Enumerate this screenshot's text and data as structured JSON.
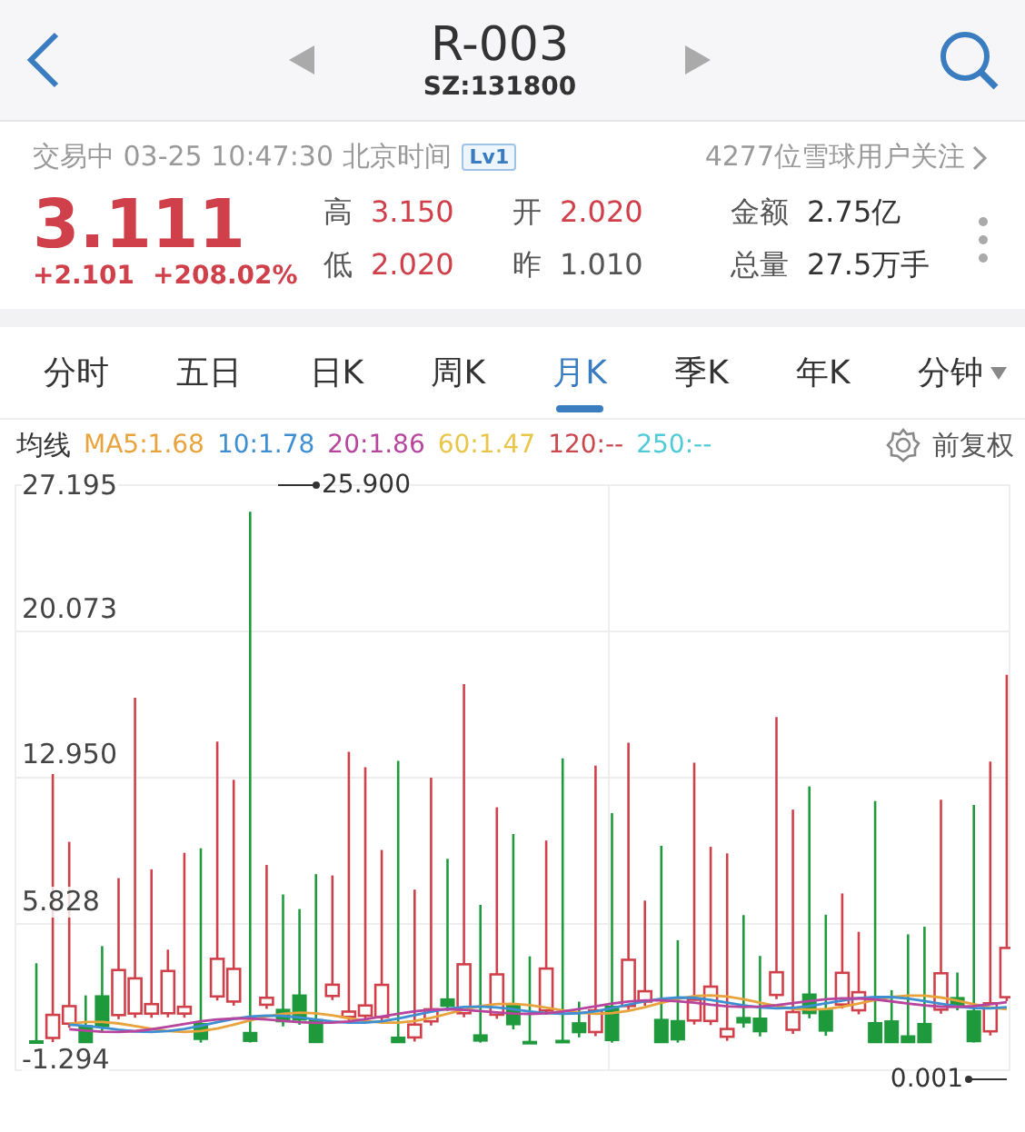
{
  "header": {
    "title": "R-003",
    "code": "SZ:131800"
  },
  "status": {
    "text": "交易中 03-25 10:47:30 北京时间",
    "level_badge": "Lv1",
    "followers": "4277位雪球用户关注"
  },
  "quote": {
    "price": "3.111",
    "change": "+2.101",
    "change_pct": "+208.02%",
    "stats": [
      {
        "label": "高",
        "value": "3.150",
        "kind": "up"
      },
      {
        "label": "开",
        "value": "2.020",
        "kind": "up"
      },
      {
        "label": "金额",
        "value": "2.75亿",
        "kind": "plain"
      },
      {
        "label": "低",
        "value": "2.020",
        "kind": "up"
      },
      {
        "label": "昨",
        "value": "1.010",
        "kind": "flat"
      },
      {
        "label": "总量",
        "value": "27.5万手",
        "kind": "plain"
      }
    ]
  },
  "tabs": [
    {
      "label": "分时",
      "selected": false,
      "kind": "tab"
    },
    {
      "label": "五日",
      "selected": false,
      "kind": "tab"
    },
    {
      "label": "日K",
      "selected": false,
      "kind": "tab"
    },
    {
      "label": "周K",
      "selected": false,
      "kind": "tab"
    },
    {
      "label": "月K",
      "selected": true,
      "kind": "tab"
    },
    {
      "label": "季K",
      "selected": false,
      "kind": "tab"
    },
    {
      "label": "年K",
      "selected": false,
      "kind": "tab"
    },
    {
      "label": "分钟",
      "selected": false,
      "kind": "dropdown"
    }
  ],
  "ma": {
    "label": "均线",
    "items": [
      {
        "text": "MA5:1.68",
        "color": "#e8a33c"
      },
      {
        "text": "10:1.78",
        "color": "#3d8fd1"
      },
      {
        "text": "20:1.86",
        "color": "#b7459e"
      },
      {
        "text": "60:1.47",
        "color": "#e9c64a"
      },
      {
        "text": "120:--",
        "color": "#c9474d"
      },
      {
        "text": "250:--",
        "color": "#4fcbd8"
      }
    ],
    "adjust": "前复权"
  },
  "chart": {
    "y_labels": [
      "27.195",
      "20.073",
      "12.950",
      "5.828",
      "-1.294"
    ],
    "max_label": "25.900",
    "min_label": "0.001"
  }
}
